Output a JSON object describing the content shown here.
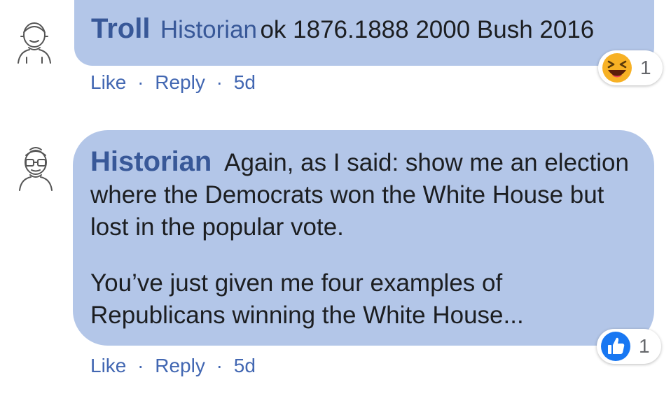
{
  "comments": [
    {
      "author": "Troll",
      "mention": "Historian",
      "text": "ok 1876.1888 2000 Bush 2016",
      "actions": {
        "like": "Like",
        "reply": "Reply",
        "time": "5d",
        "separator": "·"
      },
      "reaction": {
        "icon": "haha-icon",
        "count": "1"
      }
    },
    {
      "author": "Historian",
      "paragraphs": [
        "Again, as I said: show me an election where the Democrats won the White House but lost in the popular vote.",
        "You’ve just given me four examples of Republicans winning the White House..."
      ],
      "actions": {
        "like": "Like",
        "reply": "Reply",
        "time": "5d",
        "separator": "·"
      },
      "reaction": {
        "icon": "like-thumb-icon",
        "count": "1"
      }
    }
  ],
  "colors": {
    "bubble": "#b3c6e8",
    "link": "#385898",
    "action": "#4267b2"
  }
}
